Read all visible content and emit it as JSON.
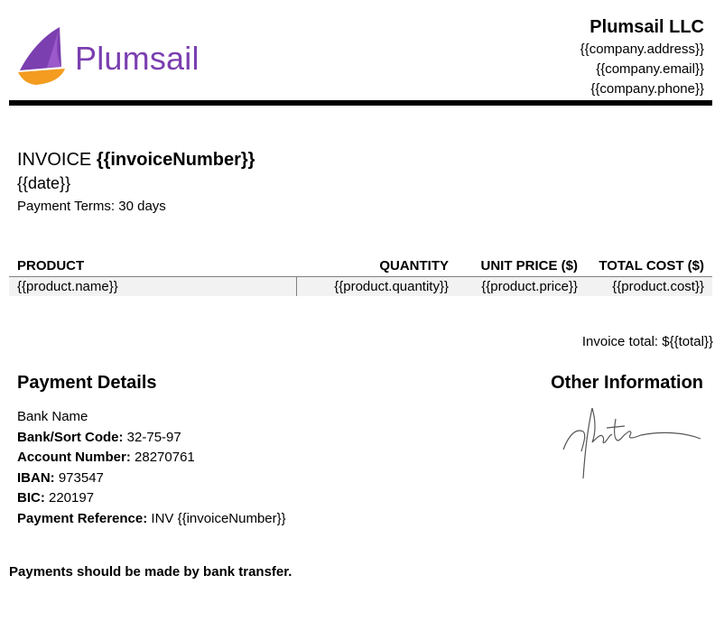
{
  "logo": {
    "text": "Plumsail",
    "colors": {
      "sail": "#7b3fb0",
      "hull": "#f39c1f"
    }
  },
  "company": {
    "name": "Plumsail LLC",
    "address": "{{company.address}}",
    "email": "{{company.email}}",
    "phone": "{{company.phone}}"
  },
  "invoice": {
    "title_prefix": "INVOICE",
    "number": "{{invoiceNumber}}",
    "date": "{{date}}",
    "terms": "Payment Terms: 30 days"
  },
  "table": {
    "headers": [
      "PRODUCT",
      "QUANTITY",
      "UNIT PRICE ($)",
      "TOTAL COST ($)"
    ],
    "rows": [
      [
        "{{product.name}}",
        "{{product.quantity}}",
        "{{product.price}}",
        "{{product.cost}}"
      ]
    ]
  },
  "total": "Invoice total: ${{total}}",
  "payment": {
    "heading": "Payment Details",
    "bank_name": "Bank Name",
    "sort_code_label": "Bank/Sort Code:",
    "sort_code": " 32-75-97",
    "account_label": "Account Number:",
    "account": " 28270761",
    "iban_label": "IBAN:",
    "iban": " 973547",
    "bic_label": "BIC:",
    "bic": " 220197",
    "reference_label": "Payment Reference:",
    "reference": " INV {{invoiceNumber}}"
  },
  "other": {
    "heading": "Other Information"
  },
  "footer": "Payments should be made by bank transfer."
}
